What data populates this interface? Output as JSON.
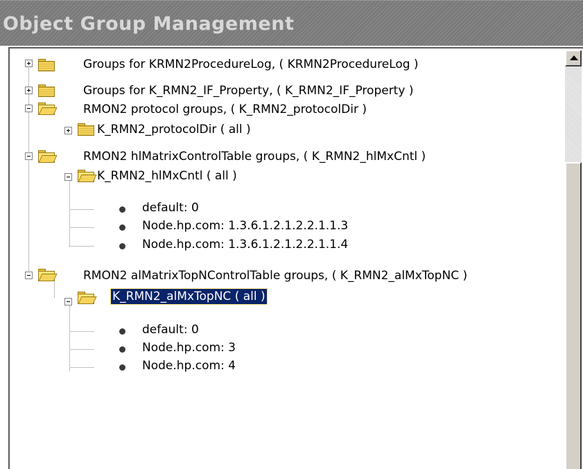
{
  "window": {
    "title": "Object Group Management"
  },
  "tree": {
    "items": [
      {
        "label": "Groups for KRMN2ProcedureLog, ( KRMN2ProcedureLog )"
      },
      {
        "label": "Groups for K_RMN2_IF_Property, ( K_RMN2_IF_Property )"
      },
      {
        "label": "RMON2 protocol groups, ( K_RMN2_protocolDir )"
      },
      {
        "label": "K_RMN2_protocolDir ( all )"
      },
      {
        "label": "RMON2 hlMatrixControlTable groups, ( K_RMN2_hlMxCntl )"
      },
      {
        "label": "K_RMN2_hlMxCntl ( all )"
      },
      {
        "label": "default: 0"
      },
      {
        "label": "Node.hp.com: 1.3.6.1.2.1.2.2.1.1.3"
      },
      {
        "label": "Node.hp.com: 1.3.6.1.2.1.2.2.1.1.4"
      },
      {
        "label": "RMON2 alMatrixTopNControlTable groups, ( K_RMN2_alMxTopNC )"
      },
      {
        "label": "K_RMN2_alMxTopNC ( all )"
      },
      {
        "label": "default: 0"
      },
      {
        "label": "Node.hp.com: 3"
      },
      {
        "label": "Node.hp.com: 4"
      }
    ],
    "selected_index": 10
  },
  "colors": {
    "selection": "#0a246a",
    "titlebar": "#7a7a7a",
    "folder": "#f5d45c"
  },
  "icons": {
    "folder_closed": "folder-icon",
    "folder_open": "folder-open-icon",
    "leaf": "leaf-dot-icon",
    "expand": "plus-box-icon",
    "collapse": "minus-box-icon"
  }
}
